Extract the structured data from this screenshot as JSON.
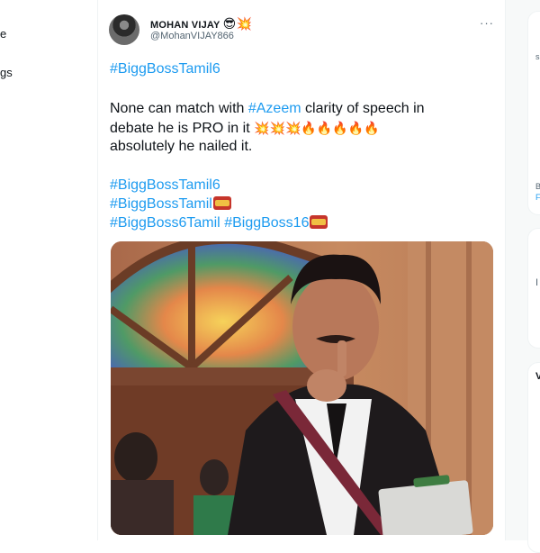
{
  "nav": {
    "item1_fragment": "e",
    "item2_fragment": "gs"
  },
  "tweet": {
    "author_name": "MOHAN VIJAY",
    "author_badges": "😎💥",
    "author_handle": "@MohanVIJAY866",
    "more_icon": "···",
    "hashtag1": "#BiggBossTamil6",
    "body_line1_pre": "None can match with ",
    "body_line1_tag": "#Azeem",
    "body_line1_post": " clarity of speech in",
    "body_line2": "debate he is PRO in it ",
    "body_line2_emojis": "💥💥💥🔥🔥🔥🔥🔥",
    "body_line3": "absolutely he nailed it.",
    "hashtag2": "#BiggBossTamil6",
    "hashtag3": "#BiggBossTamil",
    "hashtag4": "#BiggBoss6Tamil",
    "hashtag5": "#BiggBoss16"
  },
  "right_col": {
    "frag1": "s",
    "frag2": "B",
    "frag3": "F",
    "frag4": "I",
    "frag5": "V"
  }
}
